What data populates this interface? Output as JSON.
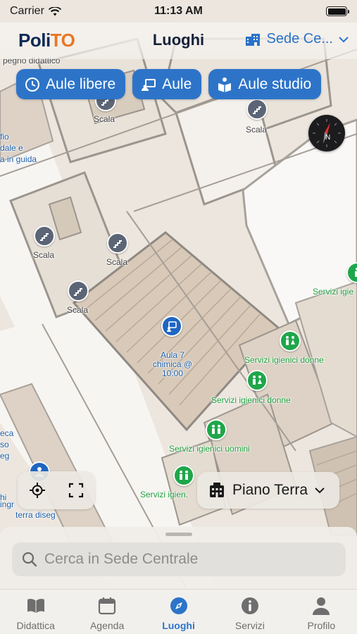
{
  "status_bar": {
    "carrier": "Carrier",
    "time": "11:13 AM"
  },
  "header": {
    "logo_left": "Poli",
    "logo_right": "TO",
    "title": "Luoghi",
    "campus": "Sede Ce..."
  },
  "filters": [
    {
      "label": "Aule libere",
      "icon": "clock-icon"
    },
    {
      "label": "Aule",
      "icon": "classroom-icon"
    },
    {
      "label": "Aule studio",
      "icon": "study-room-icon"
    }
  ],
  "map": {
    "labels": {
      "top_cut": "pegno didattico",
      "scala_1": "Scala",
      "scala_2": "Scala",
      "left_text_1": "fio",
      "left_text_2": "dale e",
      "left_text_3": "a in guida",
      "scala_3": "Scala",
      "scala_4": "Scala",
      "scala_5": "Scala",
      "servizi_right": "Servizi igie",
      "aula_7": "Aula 7\nchimica @\n10:00",
      "servizi_donne_1": "Servizi igienici donne",
      "servizi_donne_2": "Servizi igienici donne",
      "servizi_uomini": "Servizi igienici uomini",
      "servizi_igien": "Servizi igien.",
      "left_lower_1": "eca",
      "left_lower_2": "so",
      "left_lower_3": "eg",
      "left_lower_4": "hi",
      "left_lower_5": "ingr",
      "terra_diseg": "terra diseg"
    },
    "colors": {
      "floor": "#ece6de",
      "room": "#dcd0c2",
      "wall": "#a8a29c",
      "accent": "#2d74c9",
      "toilet_green": "#1fa64a"
    }
  },
  "controls": {
    "locate": "locate-icon",
    "fullscreen": "fullscreen-icon",
    "floor": "Piano Terra"
  },
  "search": {
    "placeholder": "Cerca in Sede Centrale"
  },
  "tabs": [
    {
      "label": "Didattica",
      "icon": "book-icon",
      "active": false
    },
    {
      "label": "Agenda",
      "icon": "calendar-icon",
      "active": false
    },
    {
      "label": "Luoghi",
      "icon": "compass-icon",
      "active": true
    },
    {
      "label": "Servizi",
      "icon": "info-icon",
      "active": false
    },
    {
      "label": "Profilo",
      "icon": "person-icon",
      "active": false
    }
  ]
}
